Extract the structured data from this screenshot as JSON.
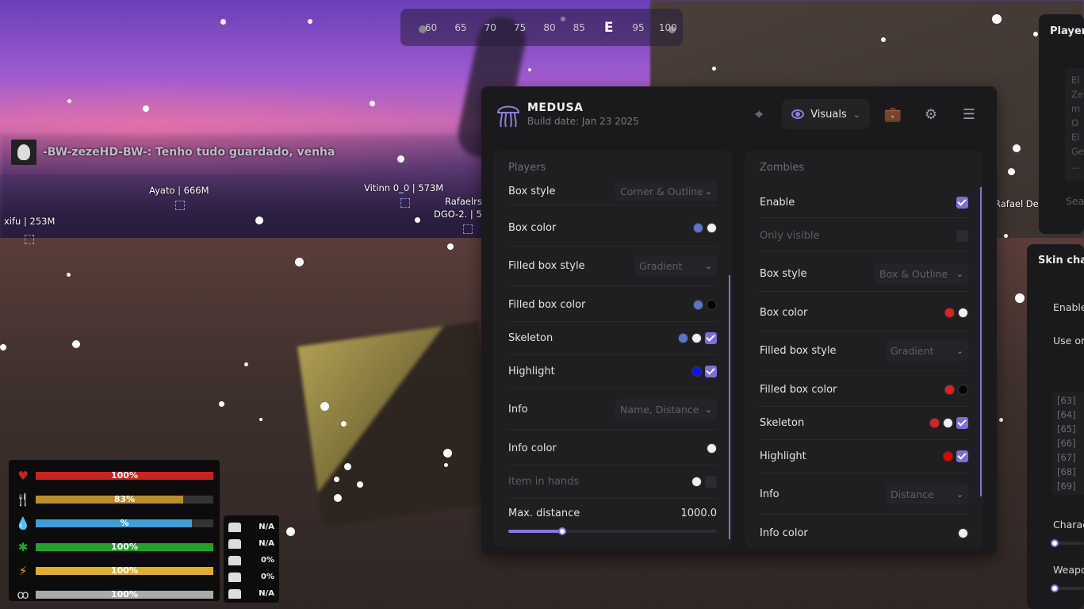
{
  "compass": {
    "ticks": [
      "60",
      "65",
      "70",
      "75",
      "80",
      "85",
      "E",
      "95",
      "100"
    ]
  },
  "chat": {
    "message": "-BW-zezeHD-BW-: Tenho tudo guardado, venha"
  },
  "tags": {
    "t1": "Ayato | 666M",
    "t2": "Vitinn 0_0 | 573M",
    "t3": "Rafaelrs",
    "t4": "DGO-2. | 5",
    "t5": "xifu | 253M",
    "t6": "Rafael De"
  },
  "hud": {
    "health": {
      "label": "100%",
      "value": 1.0,
      "color": "#cc2222"
    },
    "food": {
      "label": "83%",
      "value": 0.83,
      "color": "#b8902a"
    },
    "water": {
      "label": "%",
      "value": 0.88,
      "color": "#3aa0d8"
    },
    "immunity": {
      "label": "100%",
      "value": 1.0,
      "color": "#22a02a"
    },
    "stamina": {
      "label": "100%",
      "value": 1.0,
      "color": "#e0b020"
    },
    "oxygen": {
      "label": "100%",
      "value": 1.0,
      "color": "#aaaaaa"
    }
  },
  "equipment": [
    "N/A",
    "N/A",
    "0%",
    "0%",
    "N/A"
  ],
  "panel": {
    "brand": "MEDUSA",
    "build": "Build date: Jan 23 2025",
    "tab_label": "Visuals",
    "accent": "#7a6fd8"
  },
  "players": {
    "title": "Players",
    "box_style": {
      "label": "Box style",
      "value": "Corner & Outline"
    },
    "box_color": {
      "label": "Box color"
    },
    "filled_box_style": {
      "label": "Filled box style",
      "value": "Gradient"
    },
    "filled_box_color": {
      "label": "Filled box color"
    },
    "skeleton": {
      "label": "Skeleton"
    },
    "highlight": {
      "label": "Highlight"
    },
    "info": {
      "label": "Info",
      "value": "Name, Distance"
    },
    "info_color": {
      "label": "Info color"
    },
    "item_in_hands": {
      "label": "Item in hands"
    },
    "max_distance": {
      "label": "Max. distance",
      "value": "1000.0",
      "fraction": 0.26
    }
  },
  "zombies": {
    "title": "Zombies",
    "enable": {
      "label": "Enable"
    },
    "only_visible": {
      "label": "Only visible"
    },
    "box_style": {
      "label": "Box style",
      "value": "Box & Outline"
    },
    "box_color": {
      "label": "Box color"
    },
    "filled_box_style": {
      "label": "Filled box style",
      "value": "Gradient"
    },
    "filled_box_color": {
      "label": "Filled box color"
    },
    "skeleton": {
      "label": "Skeleton"
    },
    "highlight": {
      "label": "Highlight"
    },
    "info": {
      "label": "Info",
      "value": "Distance"
    },
    "info_color": {
      "label": "Info color"
    }
  },
  "player_panel": {
    "title": "Player",
    "list": [
      "El",
      "Ze",
      "m",
      "O",
      "El",
      "Ge",
      "..."
    ],
    "search": "Sea"
  },
  "skin_panel": {
    "title": "Skin char",
    "enable": "Enable",
    "use": "Use or",
    "list": [
      "[63]",
      "[64]",
      "[65]",
      "[66]",
      "[67]",
      "[68]",
      "[69]"
    ],
    "charac": "Charac",
    "weapon": "Weapo"
  }
}
